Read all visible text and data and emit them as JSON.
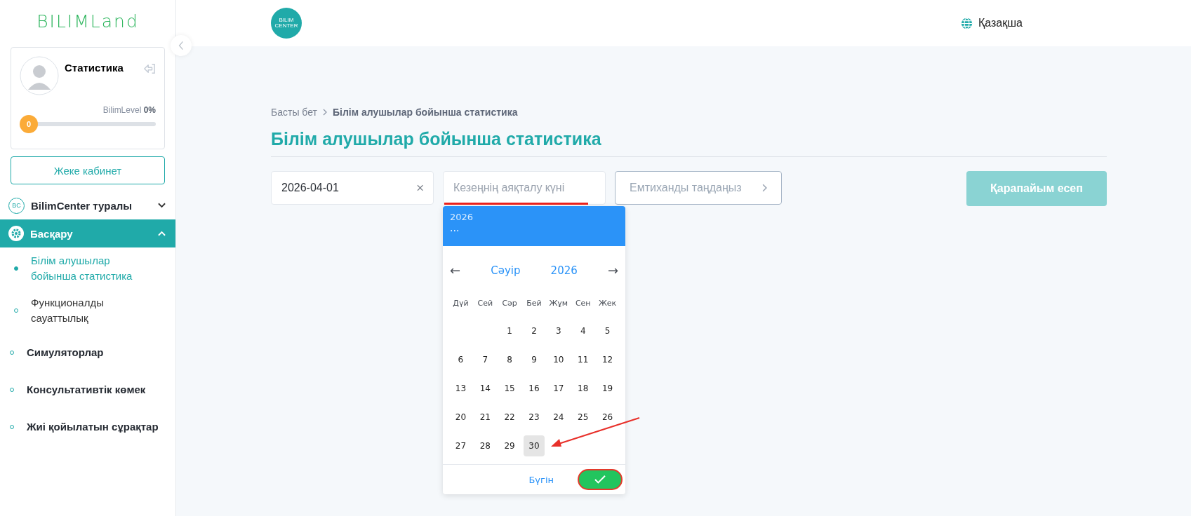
{
  "sidebar": {
    "logo": "BILIMLand",
    "profile": {
      "name": "Статистика",
      "level_badge": "0",
      "level_label": "BilimLevel",
      "level_value": "0%",
      "level": 0
    },
    "cabinet_button": "Жеке кабинет",
    "menu": [
      {
        "kind": "badge",
        "icon": "BC",
        "label": "BilimCenter туралы",
        "expanded": false,
        "selected": false
      },
      {
        "kind": "gear",
        "label": "Басқару",
        "expanded": true,
        "selected": true,
        "children": [
          {
            "label": "Білім алушылар бойынша статистика",
            "selected": true
          },
          {
            "label": "Функционалды сауаттылық",
            "selected": false
          }
        ]
      },
      {
        "kind": "link",
        "label": "Симуляторлар",
        "selected": false
      },
      {
        "kind": "link",
        "label": "Консультативтік көмек",
        "selected": false
      },
      {
        "kind": "link",
        "label": "Жиі қойылатын сұрақтар",
        "selected": false
      }
    ]
  },
  "header": {
    "logo_top": "BILIM",
    "logo_bottom": "CENTER",
    "language": "Қазақша"
  },
  "breadcrumb": [
    {
      "label": "Басты бет"
    },
    {
      "label": "Білім алушылар бойынша статистика"
    }
  ],
  "title": "Білім алушылар бойынша статистика",
  "filters": {
    "start_date": "2026-04-01",
    "end_date_placeholder": "Кезеңнің аяқталу күні",
    "exam_placeholder": "Емтиханды таңдаңыз",
    "report_button": "Қарапайым есеп"
  },
  "calendar": {
    "header_year": "2026",
    "header_date": "...",
    "month": "Сәуір",
    "year": "2026",
    "prev": "←",
    "next": "→",
    "weekdays": [
      "Дүй",
      "Сей",
      "Сәр",
      "Бей",
      "Жұм",
      "Сен",
      "Жек"
    ],
    "weeks": [
      {
        "days": [
          {
            "label": "1",
            "selected": false
          },
          {
            "label": "2",
            "selected": false
          },
          {
            "label": "3",
            "selected": false
          },
          {
            "label": "4",
            "selected": false
          },
          {
            "label": "5",
            "selected": false
          }
        ]
      },
      {
        "days": [
          {
            "label": "6",
            "selected": false
          },
          {
            "label": "7",
            "selected": false
          },
          {
            "label": "8",
            "selected": false
          },
          {
            "label": "9",
            "selected": false
          },
          {
            "label": "10",
            "selected": false
          },
          {
            "label": "11",
            "selected": false
          },
          {
            "label": "12",
            "selected": false
          }
        ]
      },
      {
        "days": [
          {
            "label": "13",
            "selected": false
          },
          {
            "label": "14",
            "selected": false
          },
          {
            "label": "15",
            "selected": false
          },
          {
            "label": "16",
            "selected": false
          },
          {
            "label": "17",
            "selected": false
          },
          {
            "label": "18",
            "selected": false
          },
          {
            "label": "19",
            "selected": false
          }
        ]
      },
      {
        "days": [
          {
            "label": "20",
            "selected": false
          },
          {
            "label": "21",
            "selected": false
          },
          {
            "label": "22",
            "selected": false
          },
          {
            "label": "23",
            "selected": false
          },
          {
            "label": "24",
            "selected": false
          },
          {
            "label": "25",
            "selected": false
          },
          {
            "label": "26",
            "selected": false
          }
        ]
      },
      {
        "days": [
          {
            "label": "27",
            "selected": false
          },
          {
            "label": "28",
            "selected": false
          },
          {
            "label": "29",
            "selected": false
          },
          {
            "label": "30",
            "selected": true
          }
        ]
      }
    ],
    "today_button": "Бүгін"
  }
}
